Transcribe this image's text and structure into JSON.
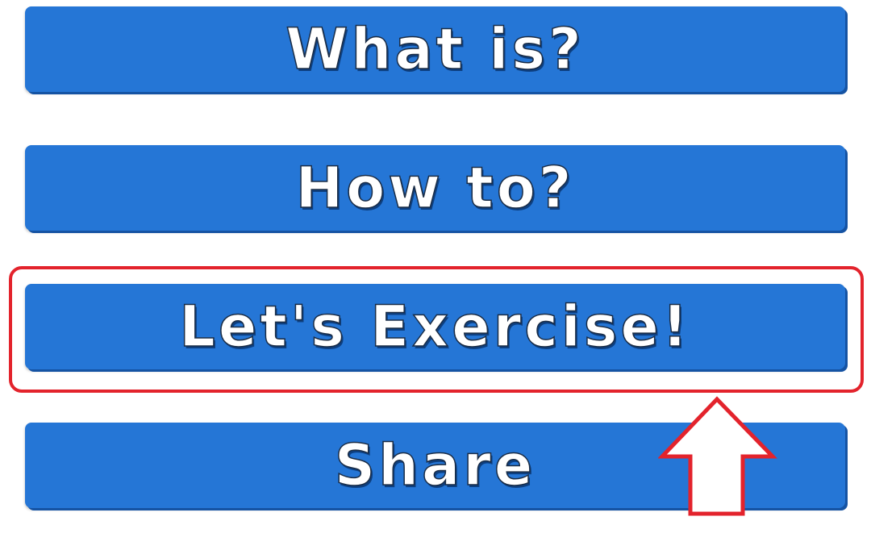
{
  "menu": {
    "what_is_label": "What is?",
    "how_to_label": "How to?",
    "exercise_label": "Let's Exercise!",
    "share_label": "Share"
  },
  "colors": {
    "button_blue": "#2576D6",
    "button_text": "#ffffff",
    "highlight_red": "#e3232c"
  },
  "annotations": {
    "highlight_target": "exercise",
    "arrow_icon": "up-arrow-icon"
  }
}
